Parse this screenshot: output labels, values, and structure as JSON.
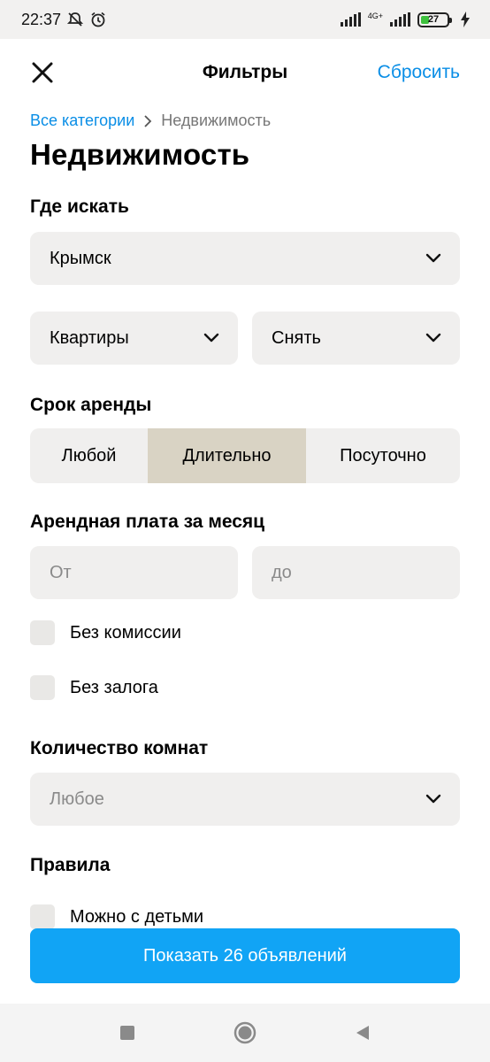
{
  "status_bar": {
    "time": "22:37",
    "network": "4G+",
    "battery": "27",
    "icons": [
      "mute-bell-icon",
      "alarm-icon",
      "signal-icon",
      "battery-icon",
      "charging-bolt-icon"
    ]
  },
  "header": {
    "title": "Фильтры",
    "reset_label": "Сбросить",
    "close_icon": "close-icon"
  },
  "breadcrumb": {
    "root": "Все категории",
    "current": "Недвижимость"
  },
  "page_title": "Недвижимость",
  "location": {
    "title": "Где искать",
    "city": "Крымск",
    "property_type": "Квартиры",
    "deal_type": "Снять"
  },
  "rent_term": {
    "title": "Срок аренды",
    "options": [
      "Любой",
      "Длительно",
      "Посуточно"
    ],
    "selected": "Длительно"
  },
  "price": {
    "title": "Арендная плата за месяц",
    "from_placeholder": "От",
    "to_placeholder": "до",
    "no_commission": "Без комиссии",
    "no_deposit": "Без залога"
  },
  "rooms": {
    "title": "Количество комнат",
    "placeholder": "Любое"
  },
  "rules": {
    "title": "Правила",
    "with_children": "Можно с детьми"
  },
  "show_button": "Показать 26 объявлений",
  "colors": {
    "accent": "#0a8ee6",
    "button": "#11a4f5",
    "field_bg": "#f0efee",
    "segment_active": "#d9d3c4"
  },
  "nav_icons": [
    "recent-apps-icon",
    "home-icon",
    "back-icon"
  ]
}
